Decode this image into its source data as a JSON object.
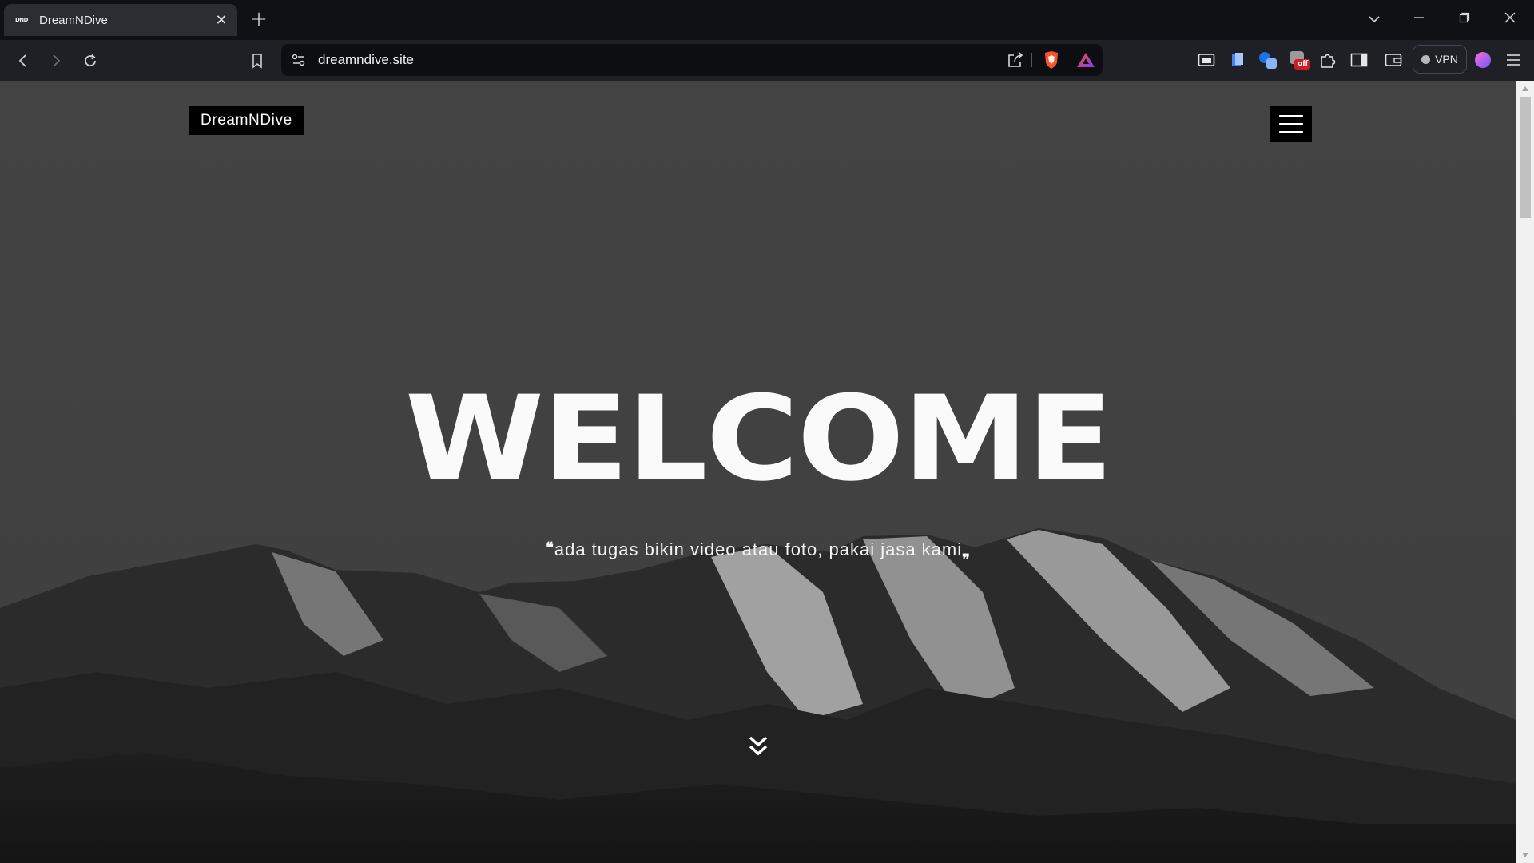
{
  "browser": {
    "tab": {
      "favicon_text": "DND",
      "title": "DreamNDive",
      "close_symbol": "✕"
    },
    "new_tab_symbol": "+",
    "address": "dreamndive.site",
    "vpn_label": "VPN",
    "extension_badge": "off"
  },
  "site": {
    "brand": "DreamNDive",
    "hero_title": "WELCOME",
    "open_quote": "❝",
    "tagline": "ada tugas bikin video atau foto, pakai jasa kami",
    "close_quote": "❞"
  },
  "colors": {
    "hero_overlay": "#414141",
    "brand_bg": "#000000",
    "text": "#ffffff"
  }
}
